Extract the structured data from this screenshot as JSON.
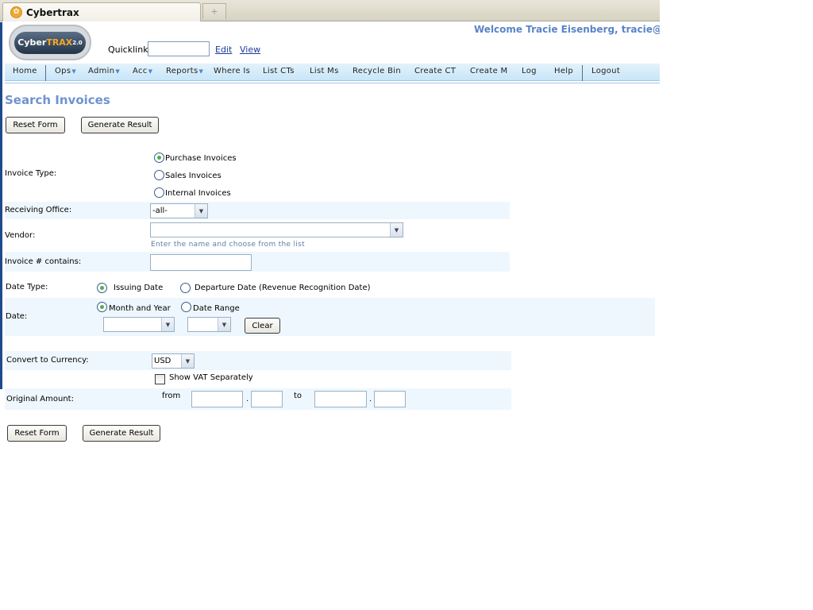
{
  "browser": {
    "tab_title": "Cybertrax",
    "tab_icon": "paw-icon",
    "new_tab_symbol": "+"
  },
  "header": {
    "logo_text_1": "Cyber",
    "logo_text_2": "TRAX",
    "logo_version": "2.0",
    "quicklink_label": "Quicklink:",
    "quicklink_value": "",
    "edit_link": "Edit",
    "view_link": "View",
    "welcome_text": "Welcome Tracie Eisenberg, tracie@jagu"
  },
  "nav": {
    "items": [
      {
        "label": "Home",
        "dropdown": false
      },
      {
        "label": "Ops",
        "dropdown": true
      },
      {
        "label": "Admin",
        "dropdown": true
      },
      {
        "label": "Acc",
        "dropdown": true
      },
      {
        "label": "Reports",
        "dropdown": true
      },
      {
        "label": "Where Is",
        "dropdown": false
      },
      {
        "label": "List CTs",
        "dropdown": false
      },
      {
        "label": "List Ms",
        "dropdown": false
      },
      {
        "label": "Recycle Bin",
        "dropdown": false
      },
      {
        "label": "Create CT",
        "dropdown": false
      },
      {
        "label": "Create M",
        "dropdown": false
      },
      {
        "label": "Log",
        "dropdown": false
      },
      {
        "label": "Help",
        "dropdown": false
      },
      {
        "label": "Logout",
        "dropdown": false
      }
    ],
    "caret": "▼"
  },
  "page": {
    "title": "Search Invoices",
    "reset_button": "Reset Form",
    "generate_button": "Generate Result"
  },
  "form": {
    "invoice_type": {
      "label": "Invoice Type:",
      "options": [
        "Purchase Invoices",
        "Sales Invoices",
        "Internal Invoices"
      ],
      "selected": "Purchase Invoices"
    },
    "receiving_office": {
      "label": "Receiving Office:",
      "value": "-all-"
    },
    "vendor": {
      "label": "Vendor:",
      "value": "",
      "hint": "Enter the name and choose from the list"
    },
    "invoice_number": {
      "label": "Invoice # contains:",
      "value": ""
    },
    "date_type": {
      "label": "Date Type:",
      "options": [
        "Issuing Date",
        "Departure Date (Revenue Recognition Date)"
      ],
      "selected": "Issuing Date"
    },
    "date": {
      "label": "Date:",
      "options": [
        "Month and Year",
        "Date Range"
      ],
      "selected": "Month and Year",
      "month_value": "",
      "year_value": "",
      "clear_button": "Clear"
    },
    "currency": {
      "label": "Convert to Currency:",
      "value": "USD"
    },
    "show_vat": {
      "label": "Show VAT Separately",
      "checked": false
    },
    "original_amount": {
      "label": "Original Amount:",
      "from_label": "from",
      "to_label": "to",
      "decimal_sep": ".",
      "from_whole": "",
      "from_decimal": "",
      "to_whole": "",
      "to_decimal": ""
    }
  }
}
